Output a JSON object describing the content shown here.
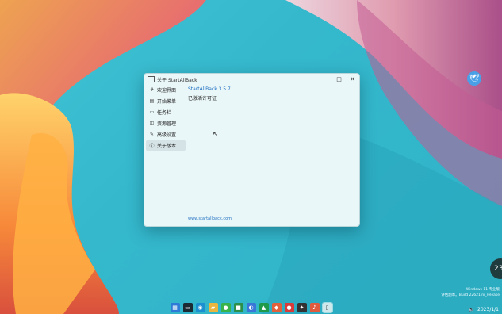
{
  "window": {
    "title": "关于 StartAllBack",
    "controls": {
      "minimize": "─",
      "maximize": "□",
      "close": "✕"
    }
  },
  "sidebar": {
    "items": [
      {
        "label": "欢迎界面",
        "icon": "hash-icon",
        "glyph": "#"
      },
      {
        "label": "开始菜单",
        "icon": "start-menu-icon",
        "glyph": "▤"
      },
      {
        "label": "任务栏",
        "icon": "taskbar-icon",
        "glyph": "▭"
      },
      {
        "label": "资源管理",
        "icon": "explorer-icon",
        "glyph": "◫"
      },
      {
        "label": "高级设置",
        "icon": "wrench-icon",
        "glyph": "✎"
      },
      {
        "label": "关于版本",
        "icon": "info-icon",
        "glyph": "ⓘ",
        "active": true
      }
    ]
  },
  "content": {
    "app_version": "StartAllBack 3.5.7",
    "license": "已激活许可证",
    "website": "www.startallback.com"
  },
  "desktop": {
    "watermark_line1": "Windows 11 专业版",
    "watermark_line2": "评估副本。Build 22621.ni_release"
  },
  "taskbar": {
    "tray_time": "2023/1/1",
    "tray_badge": "23"
  },
  "colors": {
    "accent": "#1e6fc0",
    "window_bg": "#eaf7f8",
    "desktop_teal": "#35b8cc"
  }
}
